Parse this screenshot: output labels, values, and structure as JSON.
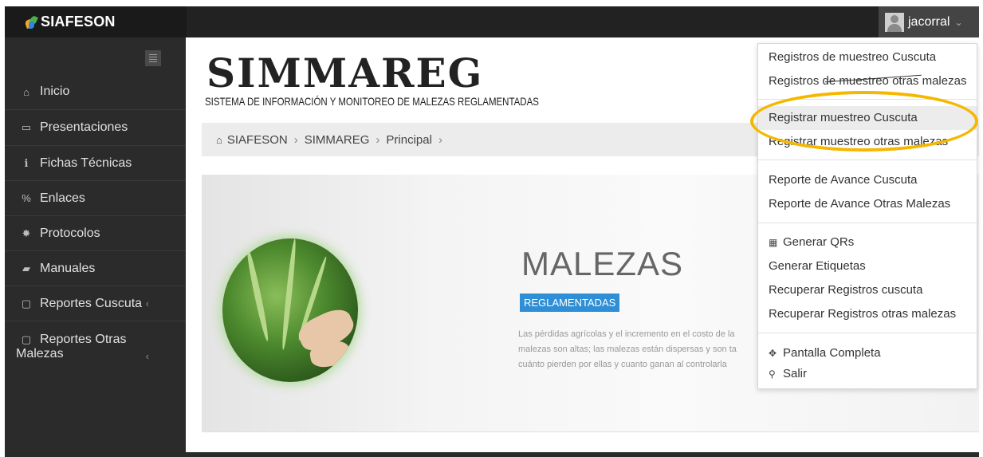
{
  "brand": {
    "name": "SIAFESON"
  },
  "user": {
    "name": "jacorral",
    "caret": "⌄"
  },
  "sidebar": {
    "items": [
      {
        "label": "Inicio",
        "icon": "⌂"
      },
      {
        "label": "Presentaciones",
        "icon": "▭"
      },
      {
        "label": "Fichas Técnicas",
        "icon": "ℹ"
      },
      {
        "label": "Enlaces",
        "icon": "%"
      },
      {
        "label": "Protocolos",
        "icon": "✸"
      },
      {
        "label": "Manuales",
        "icon": "▰"
      },
      {
        "label": "Reportes Cuscuta",
        "icon": "▢",
        "chevron": "‹"
      },
      {
        "label": "Reportes Otras",
        "label2": "Malezas",
        "icon": "▢",
        "chevron": "‹"
      }
    ]
  },
  "main": {
    "title": "SIMMAREG",
    "subtitle": "SISTEMA DE INFORMACIÓN Y MONITOREO DE MALEZAS REGLAMENTADAS",
    "breadcrumb": [
      "SIAFESON",
      "SIMMAREG",
      "Principal"
    ],
    "breadcrumb_icon": "⌂",
    "breadcrumb_sep": "›",
    "hero": {
      "heading": "MALEZAS",
      "badge": "REGLAMENTADAS",
      "lines": [
        "Las pérdidas agrícolas y el incremento en el costo de la",
        "malezas son altas; las malezas están dispersas y son ta",
        "cuánto pierden por ellas y cuanto ganan al controlarla"
      ]
    }
  },
  "dropdown": {
    "items": [
      {
        "label": "Registros de muestreo Cuscuta"
      },
      {
        "label": "Registros de muestreo otras malezas"
      },
      {
        "label": "Registrar muestreo Cuscuta",
        "highlighted": true
      },
      {
        "label": "Registrar muestreo otras malezas"
      },
      {
        "label": "Reporte de Avance Cuscuta"
      },
      {
        "label": "Reporte de Avance Otras Malezas"
      },
      {
        "label": "Generar QRs",
        "icon": "▦"
      },
      {
        "label": "Generar Etiquetas"
      },
      {
        "label": "Recuperar Registros cuscuta"
      },
      {
        "label": "Recuperar Registros otras malezas"
      },
      {
        "label": "Pantalla Completa",
        "icon": "✥"
      },
      {
        "label": "Salir",
        "icon": "⚲"
      }
    ]
  },
  "colors": {
    "topbar": "#222222",
    "sidebar": "#2b2b2b",
    "accent_badge": "#2f8fd6",
    "highlight_ring": "#f5b700"
  }
}
